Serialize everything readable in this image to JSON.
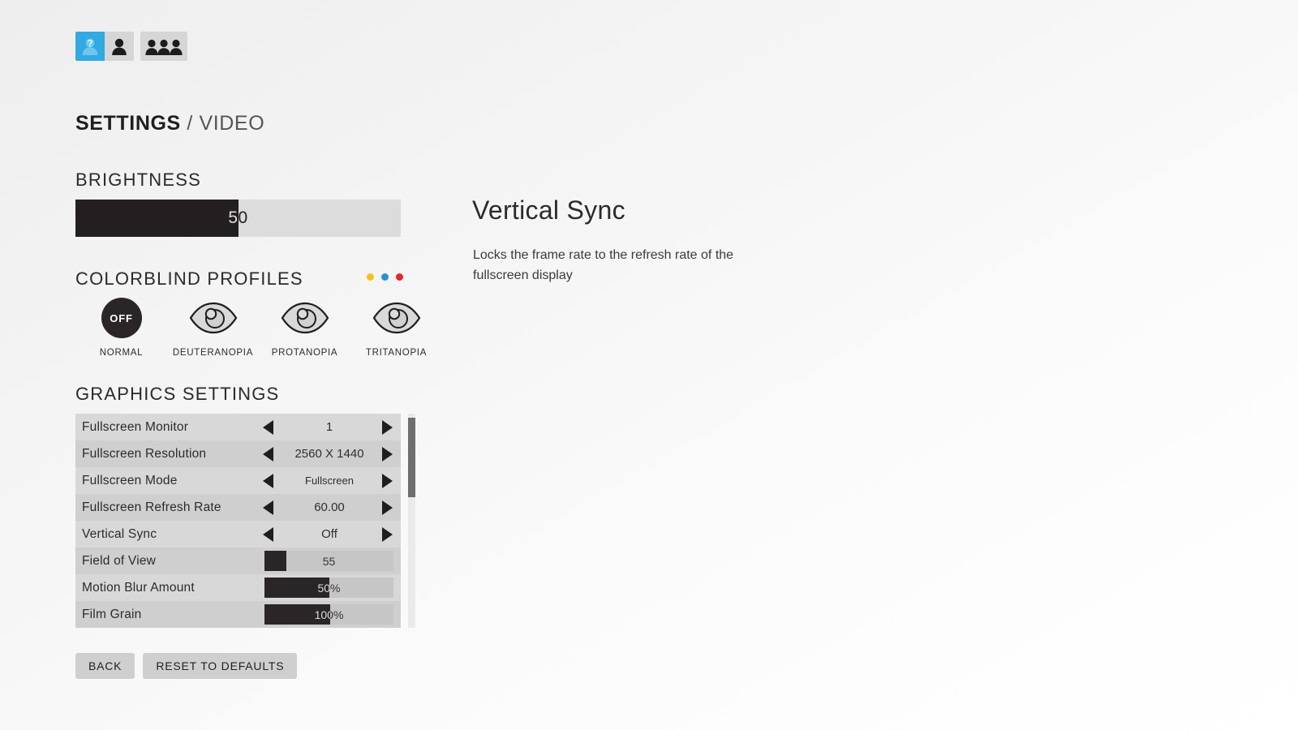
{
  "profile_bar": {
    "slots": [
      {
        "icon": "person-question-icon",
        "label": "Unknown Profile",
        "active": true
      },
      {
        "icon": "person-icon",
        "label": "Single Player Profile",
        "active": false
      },
      {
        "icon": "three-people-icon",
        "label": "Party Profile",
        "active": false
      }
    ],
    "group_two_icon": "three-people-icon"
  },
  "header": {
    "title_strong": "SETTINGS",
    "title_light": "/ VIDEO"
  },
  "brightness": {
    "heading": "BRIGHTNESS",
    "value": "50",
    "percent": 50
  },
  "colorblind": {
    "heading": "COLORBLIND PROFILES",
    "dots": [
      {
        "name": "yellow-dot",
        "color": "#f2c21a"
      },
      {
        "name": "blue-dot",
        "color": "#2b8fd4"
      },
      {
        "name": "red-dot",
        "color": "#e8252c"
      }
    ],
    "profiles": [
      {
        "label": "NORMAL",
        "icon": "off-circle-icon",
        "badge": "OFF",
        "selected": true
      },
      {
        "label": "DEUTERANOPIA",
        "icon": "eye-icon",
        "selected": false
      },
      {
        "label": "PROTANOPIA",
        "icon": "eye-icon",
        "selected": false
      },
      {
        "label": "TRITANOPIA",
        "icon": "eye-icon",
        "selected": false
      }
    ]
  },
  "graphics": {
    "heading": "GRAPHICS SETTINGS",
    "rows": [
      {
        "label": "Fullscreen Monitor",
        "type": "stepper",
        "value": "1",
        "small": false
      },
      {
        "label": "Fullscreen Resolution",
        "type": "stepper",
        "value": "2560 X 1440",
        "small": false
      },
      {
        "label": "Fullscreen Mode",
        "type": "stepper",
        "value": "Fullscreen",
        "small": true
      },
      {
        "label": "Fullscreen Refresh Rate",
        "type": "stepper",
        "value": "60.00",
        "small": false
      },
      {
        "label": "Vertical Sync",
        "type": "stepper",
        "value": "Off",
        "small": false,
        "selected": true
      },
      {
        "label": "Field of View",
        "type": "slider",
        "value": "55",
        "percent": 17
      },
      {
        "label": "Motion Blur Amount",
        "type": "slider",
        "value": "50%",
        "percent": 50
      },
      {
        "label": "Film Grain",
        "type": "slider",
        "value": "100%",
        "percent": 51
      }
    ],
    "scroll_thumb_top_pct": 2,
    "scroll_thumb_height_pct": 37
  },
  "footer": {
    "back_label": "BACK",
    "reset_label": "RESET TO DEFAULTS"
  },
  "description": {
    "title": "Vertical Sync",
    "body": "Locks the frame rate to the refresh rate of the fullscreen display"
  }
}
